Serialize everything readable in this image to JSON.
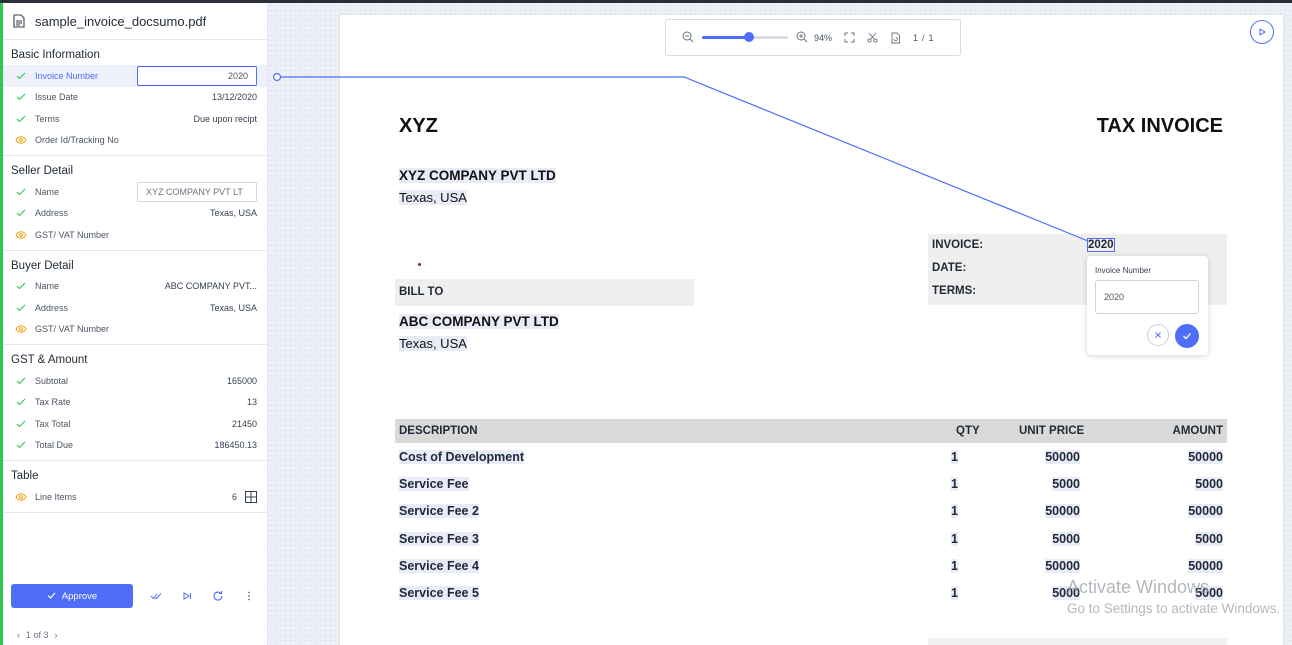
{
  "file": {
    "name": "sample_invoice_docsumo.pdf"
  },
  "sections": [
    {
      "title": "Basic Information",
      "rows": [
        {
          "label": "Invoice Number",
          "value": "2020",
          "status": "check",
          "active": true,
          "editing": true
        },
        {
          "label": "Issue Date",
          "value": "13/12/2020",
          "status": "check"
        },
        {
          "label": "Terms",
          "value": "Due upon recipt",
          "status": "check"
        },
        {
          "label": "Order Id/Tracking No",
          "value": "",
          "status": "eye"
        }
      ]
    },
    {
      "title": "Seller Detail",
      "rows": [
        {
          "label": "Name",
          "value": "XYZ COMPANY PVT LT",
          "status": "check",
          "ghostInput": true
        },
        {
          "label": "Address",
          "value": "Texas, USA",
          "status": "check"
        },
        {
          "label": "GST/ VAT Number",
          "value": "",
          "status": "eye"
        }
      ]
    },
    {
      "title": "Buyer Detail",
      "rows": [
        {
          "label": "Name",
          "value": "ABC COMPANY PVT...",
          "status": "check"
        },
        {
          "label": "Address",
          "value": "Texas, USA",
          "status": "check"
        },
        {
          "label": "GST/ VAT Number",
          "value": "",
          "status": "eye"
        }
      ]
    },
    {
      "title": "GST & Amount",
      "rows": [
        {
          "label": "Subtotal",
          "value": "165000",
          "status": "check"
        },
        {
          "label": "Tax Rate",
          "value": "13",
          "status": "check"
        },
        {
          "label": "Tax Total",
          "value": "21450",
          "status": "check"
        },
        {
          "label": "Total Due",
          "value": "186450.13",
          "status": "check"
        }
      ]
    },
    {
      "title": "Table",
      "rows": [
        {
          "label": "Line Items",
          "value": "6",
          "status": "eye",
          "gridIcon": true
        }
      ]
    }
  ],
  "actions": {
    "approve_label": "Approve"
  },
  "pager": {
    "text": "1 of 3"
  },
  "toolbar": {
    "zoom": "94%",
    "zoom_fraction": 0.55,
    "page": "1",
    "pages": "1"
  },
  "invoice": {
    "logo": "XYZ",
    "title": "TAX INVOICE",
    "seller_name": "XYZ COMPANY PVT LTD",
    "seller_address": "Texas, USA",
    "meta": [
      {
        "label": "INVOICE:",
        "value": "2020"
      },
      {
        "label": "DATE:",
        "value": ""
      },
      {
        "label": "TERMS:",
        "value": ""
      }
    ],
    "bill_to_label": "BILL TO",
    "buyer_name": "ABC COMPANY PVT LTD",
    "buyer_address": "Texas, USA",
    "columns": [
      "DESCRIPTION",
      "QTY",
      "UNIT PRICE",
      "AMOUNT"
    ],
    "items": [
      {
        "desc": "Cost of Development",
        "qty": "1",
        "price": "50000",
        "amount": "50000"
      },
      {
        "desc": "Service Fee",
        "qty": "1",
        "price": "5000",
        "amount": "5000"
      },
      {
        "desc": "Service Fee 2",
        "qty": "1",
        "price": "50000",
        "amount": "50000"
      },
      {
        "desc": "Service Fee 3",
        "qty": "1",
        "price": "5000",
        "amount": "5000"
      },
      {
        "desc": "Service Fee 4",
        "qty": "1",
        "price": "50000",
        "amount": "50000"
      },
      {
        "desc": "Service Fee 5",
        "qty": "1",
        "price": "5000",
        "amount": "5000"
      }
    ]
  },
  "popup": {
    "label": "Invoice Number",
    "value": "2020"
  },
  "watermark": {
    "line1": "Activate Windows",
    "line2": "Go to Settings to activate Windows."
  },
  "colors": {
    "accent": "#4f6ef7",
    "check": "#2ec84f",
    "eye": "#f59e0b",
    "sidebar_edge": "#2ec84f"
  }
}
